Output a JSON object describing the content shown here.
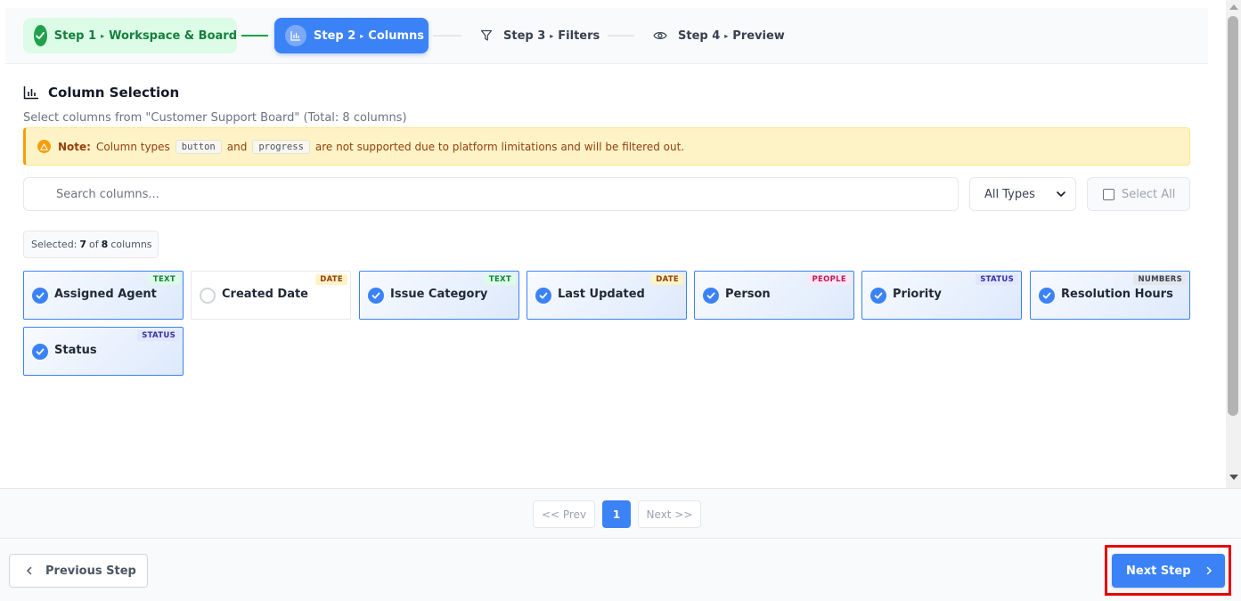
{
  "stepper": {
    "steps": [
      {
        "label": "Step 1",
        "title": "Workspace & Board",
        "state": "done"
      },
      {
        "label": "Step 2",
        "title": "Columns",
        "state": "active"
      },
      {
        "label": "Step 3",
        "title": "Filters",
        "state": "pending"
      },
      {
        "label": "Step 4",
        "title": "Preview",
        "state": "pending"
      }
    ],
    "separator": "▸"
  },
  "section": {
    "title": "Column Selection",
    "subtitle": "Select columns from \"Customer Support Board\" (Total: 8 columns)"
  },
  "note": {
    "label": "Note:",
    "text_before": "Column types",
    "type1": "button",
    "text_and": "and",
    "type2": "progress",
    "text_after": "are not supported due to platform limitations and will be filtered out."
  },
  "toolbar": {
    "search_placeholder": "Search columns...",
    "type_filter_selected": "All Types",
    "select_all_label": "Select All"
  },
  "selection": {
    "prefix": "Selected:",
    "selected": "7",
    "of": "of",
    "total": "8",
    "suffix": "columns"
  },
  "columns": [
    {
      "name": "Assigned Agent",
      "type": "TEXT",
      "selected": true
    },
    {
      "name": "Created Date",
      "type": "DATE",
      "selected": false
    },
    {
      "name": "Issue Category",
      "type": "TEXT",
      "selected": true
    },
    {
      "name": "Last Updated",
      "type": "DATE",
      "selected": true
    },
    {
      "name": "Person",
      "type": "PEOPLE",
      "selected": true
    },
    {
      "name": "Priority",
      "type": "STATUS",
      "selected": true
    },
    {
      "name": "Resolution Hours",
      "type": "NUMBERS",
      "selected": true
    },
    {
      "name": "Status",
      "type": "STATUS",
      "selected": true
    }
  ],
  "pagination": {
    "prev_label": "<< Prev",
    "current_page": "1",
    "next_label": "Next >>"
  },
  "footer": {
    "previous_label": "Previous Step",
    "next_label": "Next Step"
  },
  "colors": {
    "primary": "#3b82f6",
    "success": "#22a04b",
    "warning": "#f59e0b",
    "highlight": "#e60000"
  }
}
